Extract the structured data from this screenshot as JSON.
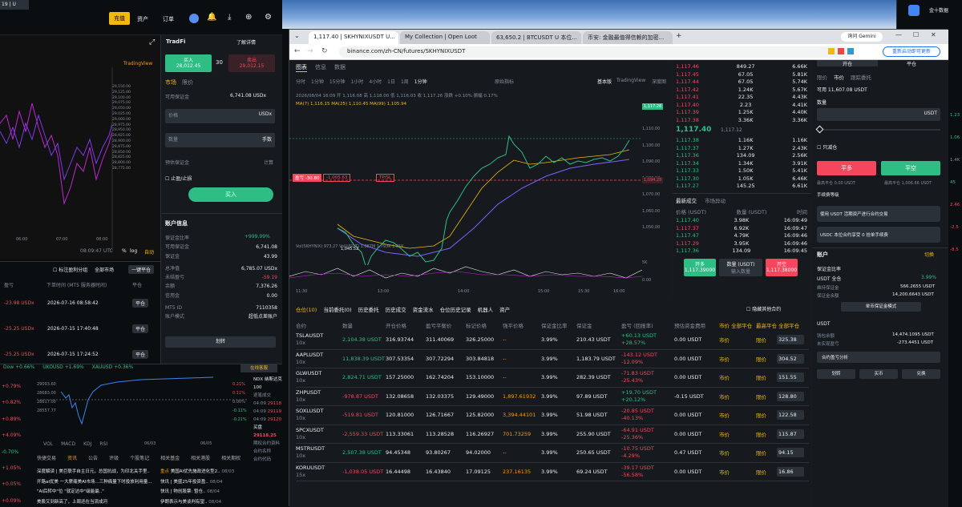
{
  "left_app": {
    "deposit_btn": "充值",
    "assets_menu": "资产",
    "orders_menu": "订单",
    "tradingview": "TradingView",
    "clock": "08:09:47 UTC",
    "log": "log",
    "auto": "自动",
    "price_labels": [
      "29,150.00",
      "29,125.00",
      "29,100.00",
      "29,075.00",
      "29,050.00",
      "29,025.00",
      "29,000.00",
      "28,975.00",
      "28,950.00",
      "28,925.00",
      "28,900.00",
      "28,875.00",
      "28,850.00",
      "28,825.00",
      "28,800.00",
      "28,775.00"
    ],
    "time_labels": [
      "06:00",
      "07:00",
      "08:00"
    ],
    "tradfi": {
      "title": "TradFi",
      "learn": "了解详情",
      "buy_label": "买入",
      "buy_price": "28,012.45",
      "spread": "30",
      "sell_label": "卖出",
      "sell_price": "29,012.15",
      "tab_market": "市场",
      "tab_limit": "限价",
      "available_label": "可用保证金",
      "available_value": "6,741.08 USDx",
      "price_label": "价格",
      "price_unit": "USDx",
      "qty_label": "数量",
      "qty_unit": "手数",
      "margin_label": "预估保证金",
      "margin_value": "计算",
      "tpsl": "止盈/止损",
      "buy_btn": "买入"
    },
    "account": {
      "title": "账户信息",
      "ratio": "+999.99%",
      "rows": [
        {
          "k": "保证金比率",
          "v": ""
        },
        {
          "k": "可用保证金",
          "v": "6,741.08"
        },
        {
          "k": "保证金",
          "v": "43.99"
        },
        {
          "k": "总净值",
          "v": "6,785.07 USDx"
        },
        {
          "k": "未结盈亏",
          "v": "-59.19"
        },
        {
          "k": "余额",
          "v": "7,376.26"
        },
        {
          "k": "信用金",
          "v": "0.00"
        },
        {
          "k": "MT5 ID",
          "v": "7110358"
        },
        {
          "k": "账户模式",
          "v": "超低点差账户"
        }
      ],
      "transfer_btn": "划转"
    },
    "pos_header": {
      "hide_other": "标注盈利分组",
      "all_markets": "全部市场",
      "close_all": "一键平仓",
      "col_pnl": "盈亏",
      "col_time": "下单时间 (MT5 服务器时间)",
      "col_close": "平仓"
    },
    "positions": [
      {
        "pnl": "-23.98 USDx",
        "time": "2026-07-16 08:58:42",
        "close": "平仓"
      },
      {
        "pnl": "-25.25 USDx",
        "time": "2026-07-15 17:40:48",
        "close": "平仓"
      },
      {
        "pnl": "-25.25 USDx",
        "time": "2026-07-15 17:24:52",
        "close": "平仓"
      }
    ],
    "ticker_strip": [
      {
        "t": "Dow +0.66%",
        "c": "green"
      },
      {
        "t": "UKOUSD +1.69%",
        "c": "green"
      },
      {
        "t": "XAUUSD +0.36%",
        "c": "green"
      }
    ],
    "online_service": "在线客服",
    "side_pcts": [
      {
        "t": "+0.79%",
        "c": "red"
      },
      {
        "t": "+0.82%",
        "c": "red"
      },
      {
        "t": "+0.89%",
        "c": "red"
      },
      {
        "t": "+4.09%",
        "c": "red"
      },
      {
        "t": "-0.70%",
        "c": "green"
      },
      {
        "t": "+1.05%",
        "c": "red"
      },
      {
        "t": "+0.05%",
        "c": "red"
      },
      {
        "t": "+0.09%",
        "c": "red"
      }
    ],
    "mini_prices": [
      "29093.60",
      "28683.00",
      "28617.00",
      "28557.77"
    ],
    "mini_pcts": [
      "0.21%",
      "0.11%",
      "0.00%",
      "-0.11%",
      "-0.21%"
    ],
    "indicators": [
      "VOL",
      "MACD",
      "KDJ",
      "RSI"
    ],
    "mini_dates": [
      "06/03",
      "06/05"
    ],
    "news_tabs": [
      "快捷交易",
      "资讯",
      "公告",
      "评级",
      "个股笔记",
      "相关基金",
      "相关港股",
      "相关期权"
    ],
    "news_left": [
      "深度解读 | 美巨联手自主日元，总国抗战，为印北关手里..",
      "开路ai优美 一大摩痛美AI市场...三种痛量下时投放利用量...",
      "\"AI后转中\"位 \"就定达中\"级能最..\"",
      "美股又到新高了，上周还在当流成河"
    ],
    "news_right": [
      {
        "tag": "重点",
        "t": "美国AI优先施政进化型2..",
        "d": "08/03"
      },
      {
        "tag": "",
        "t": "快讯 | 美盛25年投资盈..",
        "d": "08/04"
      },
      {
        "tag": "",
        "t": "快讯 | 物创股票: 暂仓..",
        "d": "08/04"
      },
      {
        "tag": "",
        "t": "伊朗表示与美谈判有望..",
        "d": "08/04"
      }
    ],
    "ndx_title": "NDX 纳斯达克100",
    "ndx_price": "29118.25",
    "ndx_label": "买盘",
    "ndx_trades": [
      {
        "time": "04:09",
        "p": "29118"
      },
      {
        "time": "04:09",
        "p": "29119"
      },
      {
        "time": "04:09",
        "p": "29120"
      }
    ],
    "ndx_caption": "逐笔成交",
    "ndx_extra": [
      "合约名称",
      "合约代码"
    ],
    "ndx_more": "期权合约资料"
  },
  "browser": {
    "tabs": [
      {
        "label": "1,117.40 | SKHYNIXUSDT U..."
      },
      {
        "label": "My Collection | Open Loot"
      },
      {
        "label": "63,650.2 | BTCUSDT U 本位..."
      },
      {
        "label": "币安: 金融最值得信赖的加密..."
      }
    ],
    "gemini": "询问 Gemini",
    "url": "binance.com/zh-CN/futures/SKHYNIXUSDT",
    "update_btn": "重新启动即可更新",
    "chart_tabs": [
      "图表",
      "信息",
      "数据"
    ],
    "intervals": [
      "分时",
      "1分钟",
      "15分钟",
      "1小时",
      "4小时",
      "1日",
      "1周",
      "1分钟"
    ],
    "indicators_btn": "原始指标",
    "basic": "基本版",
    "tradingview": "TradingView",
    "depth": "深度图",
    "ohlc": "2026/08/04 16:09  开 1,116.08  高 1,118.00  低 1,116.03  收 1,117.26  涨跌 +0.10%  振幅 0.17%",
    "ma_line": "MA(7)  1,116.15   MA(25)  1,110.45   MA(99)  1,105.94",
    "vol_line": "Vol(SKHYNIX)  973.27   Vol(USDT)  1.087M   1.793K   1.35K",
    "position_line": {
      "label": "盈亏 -30.80",
      "pnl": "-1,005.63",
      "tpsl": "TP/SL"
    },
    "last_price_tag": "1,117.26",
    "line_price_tag": "1,094.25",
    "low_label": "1,045.52",
    "y_labels": [
      "1,110.00",
      "1,100.00",
      "1,090.00",
      "1,080.00",
      "1,070.00",
      "1,060.00",
      "1,050.00"
    ],
    "vol_y": [
      "5K",
      "0.00"
    ],
    "x_labels": [
      "11:30",
      "13:00",
      "14:00",
      "15:00",
      "15:30",
      "16:00"
    ],
    "asks": [
      {
        "p": "1,117.46",
        "q": "849.27",
        "t": "6.66K"
      },
      {
        "p": "1,117.45",
        "q": "67.05",
        "t": "5.81K"
      },
      {
        "p": "1,117.44",
        "q": "67.05",
        "t": "5.74K"
      },
      {
        "p": "1,117.42",
        "q": "1.24K",
        "t": "5.67K"
      },
      {
        "p": "1,117.41",
        "q": "22.35",
        "t": "4.43K"
      },
      {
        "p": "1,117.40",
        "q": "2.23",
        "t": "4.41K"
      },
      {
        "p": "1,117.39",
        "q": "1.25K",
        "t": "4.40K"
      },
      {
        "p": "1,117.38",
        "q": "3.36K",
        "t": "3.36K"
      }
    ],
    "last_price": "1,117.40",
    "mark_price": "1,117.12",
    "bids": [
      {
        "p": "1,117.38",
        "q": "1.16K",
        "t": "1.16K"
      },
      {
        "p": "1,117.37",
        "q": "1.27K",
        "t": "2.43K"
      },
      {
        "p": "1,117.36",
        "q": "134.09",
        "t": "2.56K"
      },
      {
        "p": "1,117.34",
        "q": "1.34K",
        "t": "3.91K"
      },
      {
        "p": "1,117.33",
        "q": "1.50K",
        "t": "5.41K"
      },
      {
        "p": "1,117.30",
        "q": "1.05K",
        "t": "6.46K"
      },
      {
        "p": "1,117.27",
        "q": "145.25",
        "t": "6.61K"
      }
    ],
    "trades_tabs": [
      "最新成交",
      "市场异动"
    ],
    "trades_head": [
      "价格 (USDT)",
      "数量 (USDT)",
      "时间"
    ],
    "trades": [
      {
        "p": "1,117.40",
        "q": "3.98K",
        "t": "16:09:49",
        "c": "green"
      },
      {
        "p": "1,117.37",
        "q": "6.92K",
        "t": "16:09:47",
        "c": "red"
      },
      {
        "p": "1,117.47",
        "q": "4.79K",
        "t": "16:09:46",
        "c": "green"
      },
      {
        "p": "1,117.29",
        "q": "3.95K",
        "t": "16:09:46",
        "c": "red"
      },
      {
        "p": "1,117.36",
        "q": "134.09",
        "t": "16:09:45",
        "c": "green"
      }
    ],
    "ob_bottom": {
      "buy_label": "开多",
      "buy_price": "1,117.39000",
      "qty_label": "数量 (USDT)",
      "qty_sub": "输入数量",
      "sell_label": "开空",
      "sell_price": "1,117.38000"
    },
    "ob_head": [
      "价格",
      "数量",
      "合计"
    ],
    "order_form": {
      "tab_open": "开仓",
      "tab_close": "平仓",
      "types": [
        "限价",
        "市价",
        "跟踪委托"
      ],
      "available": "可用 11,607.08 USDT",
      "qty_label": "数量",
      "qty_unit": "USDT",
      "reduce_only": "只减仓",
      "btn_close_long": "平多",
      "btn_close_short": "平空",
      "max_left": "最高平仓 0.00 USDT",
      "max_right": "最高平仓 1,006.66 USDT",
      "fee_tier": "手续费等级",
      "promo1": "使用 USDT 活期资产进行合约交易",
      "promo2": "USDC 本位合约享受 0 挂单手续费",
      "account_title": "账户",
      "switch": "切换",
      "margin_ratio_label": "保证金比率",
      "usdt_mode": "USDT 全仓",
      "mr_value": "3.99%",
      "maint_label": "维持保证金",
      "maint_value": "566.2655 USDT",
      "balance_label": "保证金余额",
      "balance_value": "14,200.6643 USDT",
      "single_asset": "单币保证金模式",
      "usdt": "USDT",
      "wallet_label": "钱包余额",
      "wallet_value": "14,474.1095 USDT",
      "upnl_label": "未实现盈亏",
      "upnl_value": "-273.4451 USDT",
      "pnl_analysis": "合约盈亏分析",
      "btns": [
        "划转",
        "买币",
        "兑换"
      ]
    },
    "pos_tabs": [
      "仓位(10)",
      "当前委托(0)",
      "历史委托",
      "历史成交",
      "资金流水",
      "仓位历史记录",
      "机器人",
      "资产"
    ],
    "hide_other": "隐藏其他合约",
    "pos_head": [
      "合约",
      "数量",
      "开仓价格",
      "盈亏平衡价",
      "标记价格",
      "强平价格",
      "保证金比率",
      "保证金",
      "盈亏 (回报率)",
      "预估资金费用",
      "市价 全部平仓",
      "最高平仓 全部平仓"
    ],
    "positions": [
      {
        "sym": "TSLAUSDT",
        "lev": "10x",
        "qty": "2,104.38 USDT",
        "entry": "316.93744",
        "be": "311.40069",
        "mark": "326.25000",
        "liq": "--",
        "mr": "3.99%",
        "margin": "210.43 USDT",
        "pnl": "+60.13 USDT",
        "roe": "+28.57%",
        "fee": "0.00 USDT",
        "qtyin": "325.38",
        "pc": "green"
      },
      {
        "sym": "AAPLUSDT",
        "lev": "10x",
        "qty": "11,838.39 USDT",
        "entry": "307.53354",
        "be": "307.72294",
        "mark": "303.84818",
        "liq": "--",
        "mr": "3.99%",
        "margin": "1,183.79 USDT",
        "pnl": "-143.12 USDT",
        "roe": "-12.09%",
        "fee": "0.00 USDT",
        "qtyin": "304.52",
        "pc": "red"
      },
      {
        "sym": "GLWUSDT",
        "lev": "10x",
        "qty": "2,824.71 USDT",
        "entry": "157.25000",
        "be": "162.74204",
        "mark": "153.10000",
        "liq": "--",
        "mr": "3.99%",
        "margin": "282.39 USDT",
        "pnl": "-71.83 USDT",
        "roe": "-25.43%",
        "fee": "0.00 USDT",
        "qtyin": "151.55",
        "pc": "red"
      },
      {
        "sym": "ZHPUSDT",
        "lev": "10x",
        "qty": "-978.87 USDT",
        "entry": "132.08658",
        "be": "132.03375",
        "mark": "129.49000",
        "liq": "1,897.61932",
        "mr": "3.99%",
        "margin": "97.89 USDT",
        "pnl": "+19.70 USDT",
        "roe": "+20.12%",
        "fee": "-0.15 USDT",
        "qtyin": "128.80",
        "pc": "green"
      },
      {
        "sym": "SOXLUSDT",
        "lev": "10x",
        "qty": "-519.81 USDT",
        "entry": "120.81000",
        "be": "126.71667",
        "mark": "125.82000",
        "liq": "3,394.44101",
        "mr": "3.99%",
        "margin": "51.98 USDT",
        "pnl": "-20.85 USDT",
        "roe": "-40.13%",
        "fee": "0.00 USDT",
        "qtyin": "122.58",
        "pc": "red"
      },
      {
        "sym": "SPCXUSDT",
        "lev": "10x",
        "qty": "-2,559.33 USDT",
        "entry": "113.33061",
        "be": "113.28528",
        "mark": "116.26927",
        "liq": "701.73259",
        "mr": "3.99%",
        "margin": "255.90 USDT",
        "pnl": "-64.91 USDT",
        "roe": "-25.36%",
        "fee": "0.00 USDT",
        "qtyin": "115.87",
        "pc": "red"
      },
      {
        "sym": "MSTRUSDT",
        "lev": "10x",
        "qty": "2,507.38 USDT",
        "entry": "94.45348",
        "be": "93.80267",
        "mark": "94.02000",
        "liq": "--",
        "mr": "3.99%",
        "margin": "250.65 USDT",
        "pnl": "-10.75 USDT",
        "roe": "-4.29%",
        "fee": "0.47 USDT",
        "qtyin": "94.15",
        "pc": "red"
      },
      {
        "sym": "KORUUSDT",
        "lev": "15x",
        "qty": "-1,038.05 USDT",
        "entry": "16.44498",
        "be": "16.43840",
        "mark": "17.09125",
        "liq": "237.16135",
        "mr": "3.99%",
        "margin": "69.24 USDT",
        "pnl": "-39.17 USDT",
        "roe": "-56.58%",
        "fee": "0.00 USDT",
        "qtyin": "16.86",
        "pc": "red"
      }
    ],
    "pos_row_market": "市价",
    "pos_row_limit": "限价"
  },
  "rightstrip": {
    "title": "金十数据",
    "vals": [
      {
        "t": "1.23",
        "c": "green"
      },
      {
        "t": "1.06",
        "c": "green"
      },
      {
        "t": "1.4K",
        "c": "muted"
      },
      {
        "t": "45",
        "c": "green"
      },
      {
        "t": "2.46",
        "c": "red"
      },
      {
        "t": "-2.5",
        "c": "red"
      },
      {
        "t": "-8.5",
        "c": "red"
      }
    ]
  }
}
